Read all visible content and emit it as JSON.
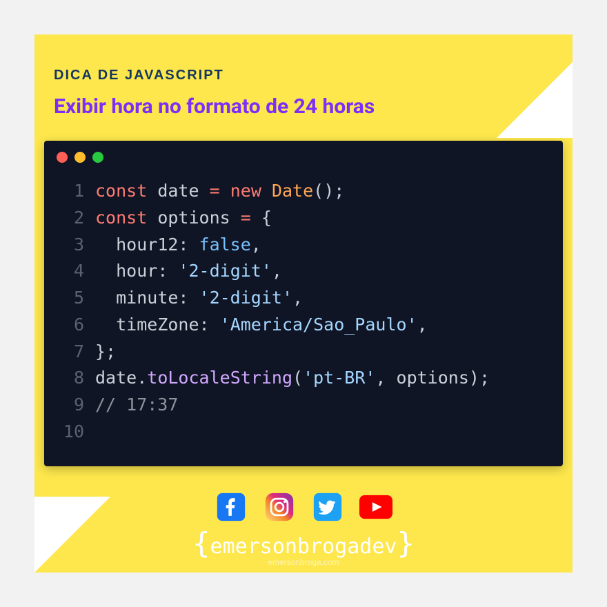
{
  "header": {
    "kicker": "DICA DE JAVASCRIPT",
    "title": "Exibir hora no formato de 24 horas"
  },
  "code": {
    "lines": {
      "l1": {
        "n": "1",
        "kw1": "const",
        "id": "date",
        "op": "=",
        "kw2": "new",
        "cls": "Date",
        "tail": "();"
      },
      "l2": {
        "n": "2",
        "kw1": "const",
        "id": "options",
        "op": "=",
        "brace": "{"
      },
      "l3": {
        "n": "3",
        "key": "hour12",
        "sep": ": ",
        "val": "false",
        "comma": ","
      },
      "l4": {
        "n": "4",
        "key": "hour",
        "sep": ": ",
        "val": "'2-digit'",
        "comma": ","
      },
      "l5": {
        "n": "5",
        "key": "minute",
        "sep": ": ",
        "val": "'2-digit'",
        "comma": ","
      },
      "l6": {
        "n": "6",
        "key": "timeZone",
        "sep": ": ",
        "val": "'America/Sao_Paulo'",
        "comma": ","
      },
      "l7": {
        "n": "7",
        "brace": "};"
      },
      "l8": {
        "n": "8",
        "obj": "date",
        "dot": ".",
        "fn": "toLocaleString",
        "open": "(",
        "arg1": "'pt-BR'",
        "comma": ", ",
        "arg2": "options",
        "close": ");"
      },
      "l9": {
        "n": "9",
        "comment": "// 17:37"
      },
      "l10": {
        "n": "10"
      }
    }
  },
  "footer": {
    "brand": "emersonbrogadev",
    "site": "emersonbroga.com"
  }
}
